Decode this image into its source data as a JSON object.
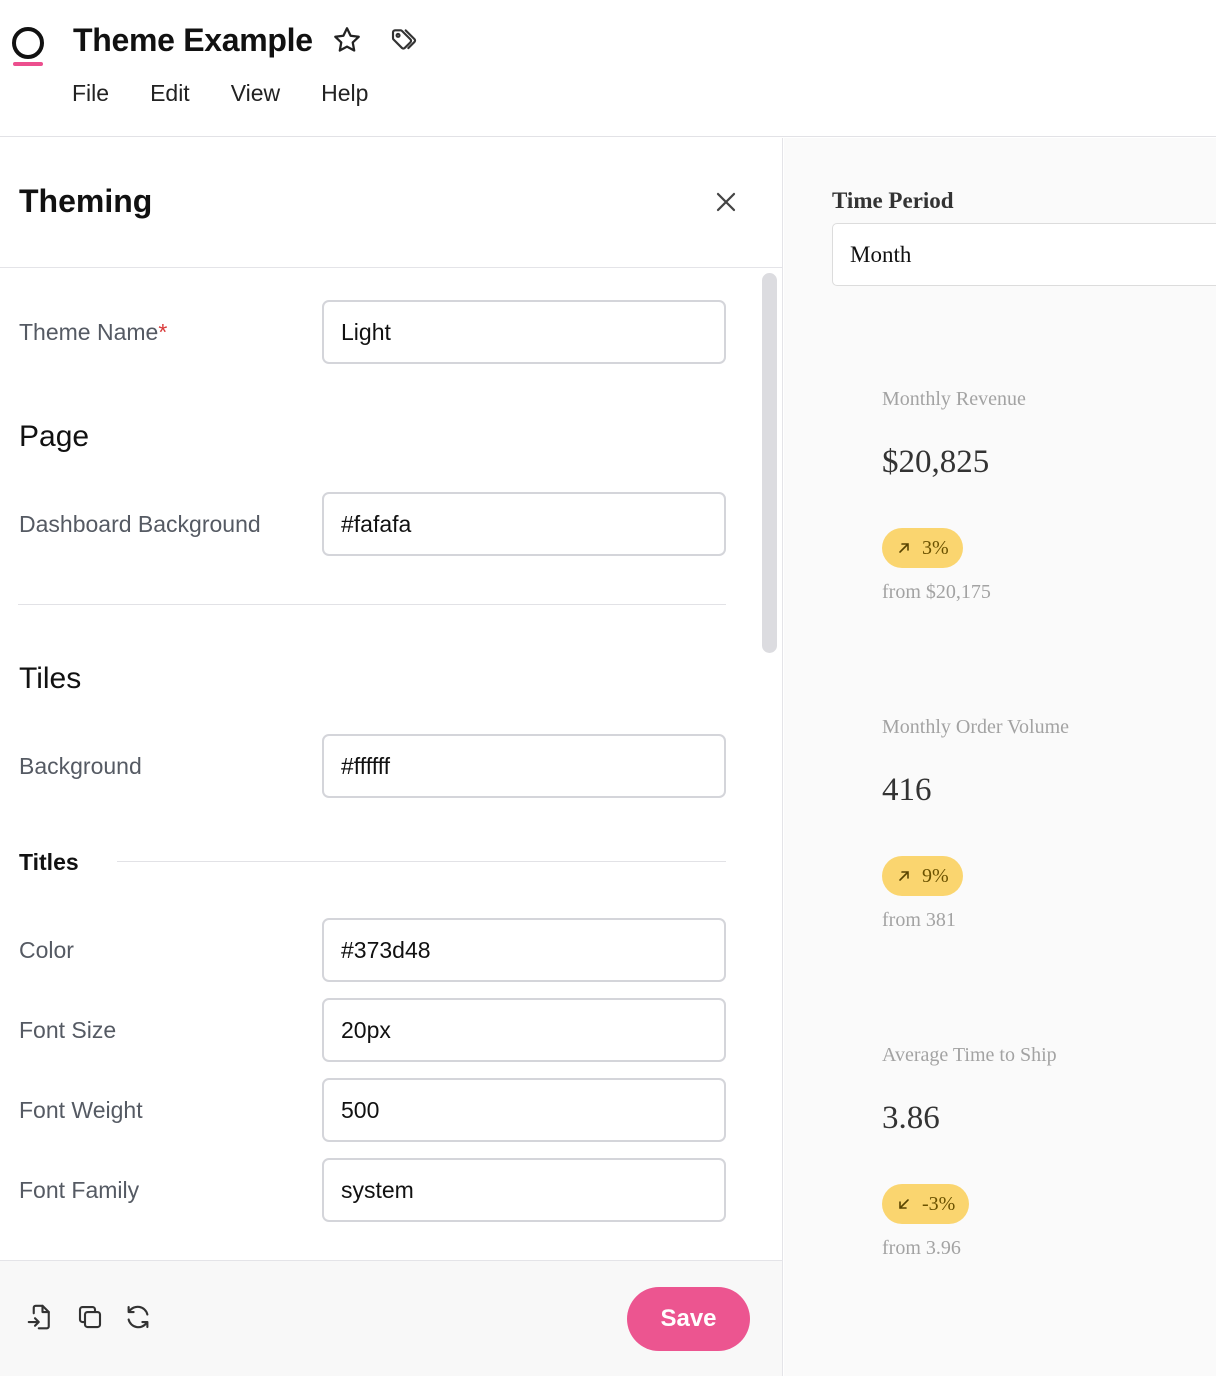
{
  "app": {
    "title": "Theme Example",
    "menu": [
      "File",
      "Edit",
      "View",
      "Help"
    ],
    "icons": {
      "logo": "logo-ring",
      "favorite": "star-icon",
      "tags": "tag-icon"
    }
  },
  "panel": {
    "title": "Theming",
    "close_icon": "close-icon",
    "theme_name": {
      "label": "Theme Name",
      "required_mark": "*",
      "value": "Light"
    },
    "page": {
      "title": "Page",
      "dashboard_background": {
        "label": "Dashboard Background",
        "value": "#fafafa"
      }
    },
    "tiles": {
      "title": "Tiles",
      "background": {
        "label": "Background",
        "value": "#ffffff"
      },
      "titles": {
        "title": "Titles",
        "color": {
          "label": "Color",
          "value": "#373d48"
        },
        "font_size": {
          "label": "Font Size",
          "value": "20px"
        },
        "font_weight": {
          "label": "Font Weight",
          "value": "500"
        },
        "font_family": {
          "label": "Font Family",
          "value": "system"
        }
      }
    },
    "footer": {
      "icons": [
        "import-icon",
        "duplicate-icon",
        "reset-icon"
      ],
      "save_label": "Save",
      "save_color": "#ec5590"
    }
  },
  "dashboard": {
    "background": "#fafafa",
    "time_period": {
      "label": "Time Period",
      "value": "Month"
    },
    "kpis": [
      {
        "title": "Monthly Revenue",
        "value": "$20,825",
        "change": "3%",
        "direction": "up",
        "from": "from $20,175"
      },
      {
        "title": "Monthly Order Volume",
        "value": "416",
        "change": "9%",
        "direction": "up",
        "from": "from 381"
      },
      {
        "title": "Average Time to Ship",
        "value": "3.86",
        "change": "-3%",
        "direction": "down",
        "from": "from 3.96"
      }
    ],
    "badge_color": "#fad56f"
  }
}
